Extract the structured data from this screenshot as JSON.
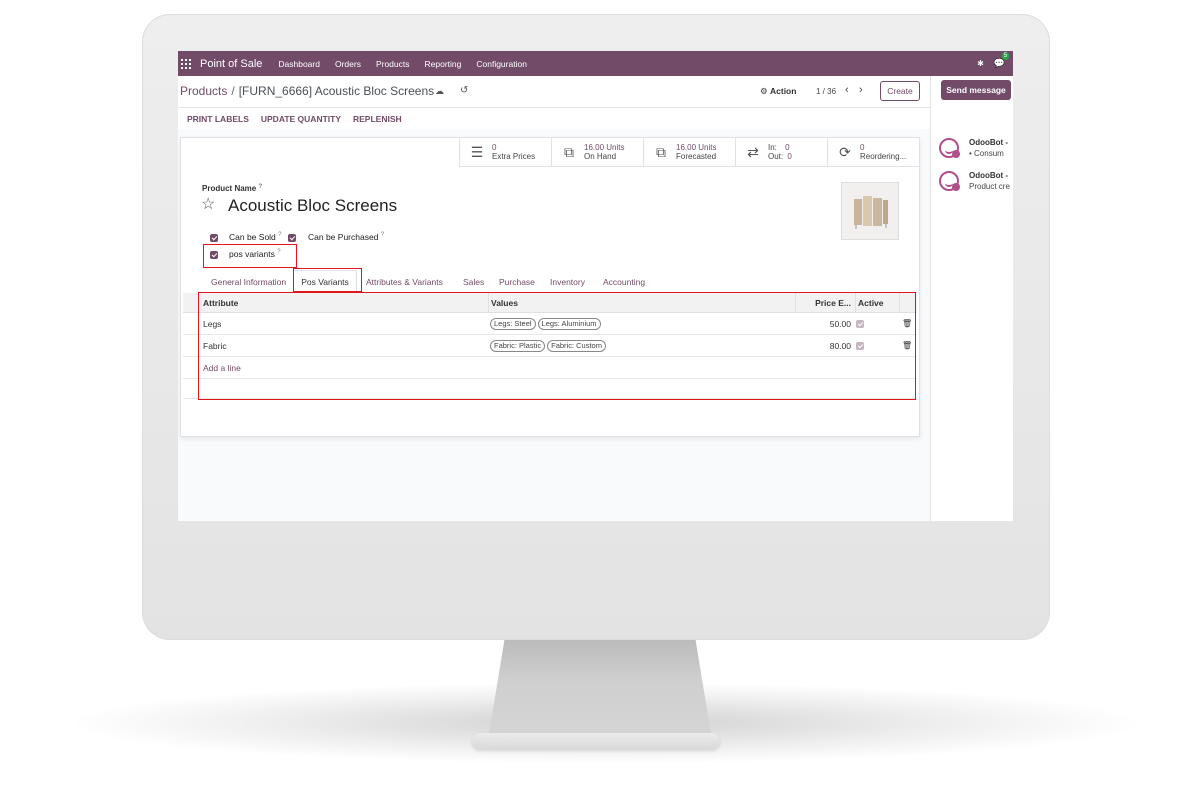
{
  "navbar": {
    "app_title": "Point of Sale",
    "menu": [
      "Dashboard",
      "Orders",
      "Products",
      "Reporting",
      "Configuration"
    ],
    "message_count": "5"
  },
  "breadcrumb": {
    "parent": "Products",
    "separator": "/",
    "current": "[FURN_6666] Acoustic Bloc Screens"
  },
  "control": {
    "action_label": "Action",
    "pager": "1 / 36",
    "create_label": "Create"
  },
  "statusbar": {
    "buttons": [
      "PRINT LABELS",
      "UPDATE QUANTITY",
      "REPLENISH"
    ]
  },
  "stats": [
    {
      "value": "0",
      "label": "Extra Prices",
      "icon": "list-icon"
    },
    {
      "value": "16.00 Units",
      "label": "On Hand",
      "icon": "cubes-icon"
    },
    {
      "value": "16.00 Units",
      "label": "Forecasted",
      "icon": "cubes-icon"
    },
    {
      "in_label": "In:",
      "in_value": "0",
      "out_label": "Out:",
      "out_value": "0",
      "icon": "exchange-icon"
    },
    {
      "value": "0",
      "label": "Reordering...",
      "icon": "refresh-icon"
    }
  ],
  "form": {
    "name_label": "Product Name",
    "help": "?",
    "product_name": "Acoustic Bloc Screens",
    "can_be_sold": "Can be Sold",
    "can_be_purchased": "Can be Purchased",
    "pos_variants": "pos variants"
  },
  "tabs": [
    "General Information",
    "Pos Variants",
    "Attributes & Variants",
    "Sales",
    "Purchase",
    "Inventory",
    "Accounting"
  ],
  "grid": {
    "headers": {
      "attribute": "Attribute",
      "values": "Values",
      "price": "Price E...",
      "active": "Active"
    },
    "rows": [
      {
        "attribute": "Legs",
        "values": [
          "Legs: Steel",
          "Legs: Aluminium"
        ],
        "price": "50.00",
        "active": true
      },
      {
        "attribute": "Fabric",
        "values": [
          "Fabric: Plastic",
          "Fabric: Custom"
        ],
        "price": "80.00",
        "active": true
      }
    ],
    "add_line": "Add a line"
  },
  "chatter": {
    "send_message": "Send message",
    "messages": [
      {
        "author": "OdooBot -",
        "body": "• Consum"
      },
      {
        "author": "OdooBot -",
        "body": "Product cre"
      }
    ]
  },
  "colors": {
    "primary": "#714b67",
    "highlight": "#e0161d"
  }
}
